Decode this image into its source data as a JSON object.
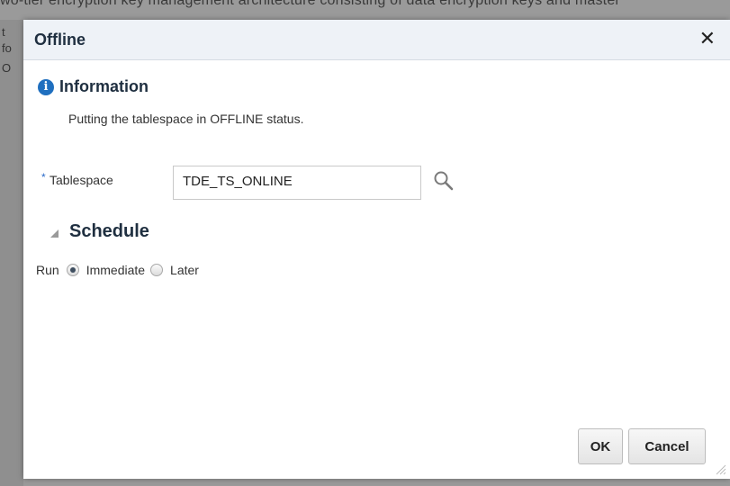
{
  "background": {
    "text": "wo-tier encryption key management architecture consisting of data encryption keys and master"
  },
  "dialog": {
    "title": "Offline",
    "close_icon": "close-icon",
    "info": {
      "icon": "info-icon",
      "title": "Information",
      "message": "Putting the tablespace in OFFLINE status."
    },
    "tablespace": {
      "required_marker": "*",
      "label": "Tablespace",
      "value": "TDE_TS_ONLINE",
      "search_icon": "search-icon"
    },
    "schedule": {
      "title": "Schedule",
      "run_label": "Run",
      "options": [
        "Immediate",
        "Later"
      ],
      "selected": "Immediate"
    },
    "buttons": {
      "ok": "OK",
      "cancel": "Cancel"
    }
  },
  "colors": {
    "accent": "#1f6fbf",
    "title_text": "#1f2f40",
    "titlebar_bg": "#eef2f7"
  }
}
